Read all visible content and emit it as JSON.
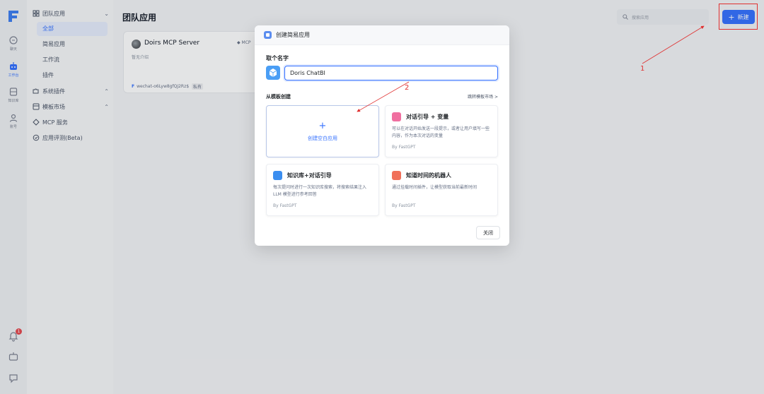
{
  "rail": {
    "items": [
      {
        "label": "聊天",
        "icon": "chat-icon"
      },
      {
        "label": "工作台",
        "icon": "robot-icon"
      },
      {
        "label": "知识库",
        "icon": "database-icon"
      },
      {
        "label": "账号",
        "icon": "user-icon"
      }
    ],
    "notification_count": "1"
  },
  "nav": {
    "team_apps": "团队应用",
    "sub_items": [
      "全部",
      "简易应用",
      "工作流",
      "插件"
    ],
    "system_plugins": "系统插件",
    "template_market": "模板市场",
    "mcp_service": "MCP 服务",
    "app_eval": "应用评测(Beta)"
  },
  "main": {
    "title": "团队应用",
    "search_placeholder": "搜索应用",
    "new_button": "新建",
    "app_card": {
      "name": "Doirs MCP Server",
      "tag": "MCP",
      "desc": "暂无介绍",
      "owner": "wechat-o6Lyw8gfQJ2Rz$",
      "visibility": "私有"
    }
  },
  "modal": {
    "title": "创建简易应用",
    "name_label": "取个名字",
    "name_value": "Doris ChatBI",
    "template_label": "从模板创建",
    "jump_link": "跳转模板市场 >",
    "blank_plus": "+",
    "blank_label": "创建空白应用",
    "templates": [
      {
        "title": "对话引导 + 变量",
        "desc": "可以在对话开始发送一段提示，或者让用户填写一些内容，作为本次对话的变量",
        "by": "By FastGPT",
        "color": "#f06fa0"
      },
      {
        "title": "知识库+对话引导",
        "desc": "每次提问时进行一次知识库搜索，将搜索结果注入 LLM 模型进行参考回答",
        "by": "By FastGPT",
        "color": "#3b8ef0"
      },
      {
        "title": "知道时间的机器人",
        "desc": "通过挂载时间插件，让模型获取当前最新时间",
        "by": "By FastGPT",
        "color": "#f0705a"
      }
    ],
    "close_button": "关闭"
  },
  "annotations": {
    "one": "1",
    "two": "2",
    "color": "#e03030"
  }
}
